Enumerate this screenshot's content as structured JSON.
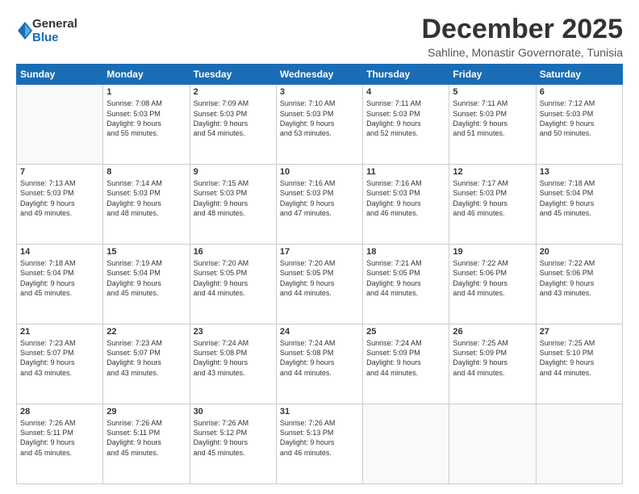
{
  "logo": {
    "general": "General",
    "blue": "Blue"
  },
  "header": {
    "title": "December 2025",
    "subtitle": "Sahline, Monastir Governorate, Tunisia"
  },
  "weekdays": [
    "Sunday",
    "Monday",
    "Tuesday",
    "Wednesday",
    "Thursday",
    "Friday",
    "Saturday"
  ],
  "weeks": [
    [
      {
        "day": "",
        "info": ""
      },
      {
        "day": "1",
        "info": "Sunrise: 7:08 AM\nSunset: 5:03 PM\nDaylight: 9 hours\nand 55 minutes."
      },
      {
        "day": "2",
        "info": "Sunrise: 7:09 AM\nSunset: 5:03 PM\nDaylight: 9 hours\nand 54 minutes."
      },
      {
        "day": "3",
        "info": "Sunrise: 7:10 AM\nSunset: 5:03 PM\nDaylight: 9 hours\nand 53 minutes."
      },
      {
        "day": "4",
        "info": "Sunrise: 7:11 AM\nSunset: 5:03 PM\nDaylight: 9 hours\nand 52 minutes."
      },
      {
        "day": "5",
        "info": "Sunrise: 7:11 AM\nSunset: 5:03 PM\nDaylight: 9 hours\nand 51 minutes."
      },
      {
        "day": "6",
        "info": "Sunrise: 7:12 AM\nSunset: 5:03 PM\nDaylight: 9 hours\nand 50 minutes."
      }
    ],
    [
      {
        "day": "7",
        "info": "Sunrise: 7:13 AM\nSunset: 5:03 PM\nDaylight: 9 hours\nand 49 minutes."
      },
      {
        "day": "8",
        "info": "Sunrise: 7:14 AM\nSunset: 5:03 PM\nDaylight: 9 hours\nand 48 minutes."
      },
      {
        "day": "9",
        "info": "Sunrise: 7:15 AM\nSunset: 5:03 PM\nDaylight: 9 hours\nand 48 minutes."
      },
      {
        "day": "10",
        "info": "Sunrise: 7:16 AM\nSunset: 5:03 PM\nDaylight: 9 hours\nand 47 minutes."
      },
      {
        "day": "11",
        "info": "Sunrise: 7:16 AM\nSunset: 5:03 PM\nDaylight: 9 hours\nand 46 minutes."
      },
      {
        "day": "12",
        "info": "Sunrise: 7:17 AM\nSunset: 5:03 PM\nDaylight: 9 hours\nand 46 minutes."
      },
      {
        "day": "13",
        "info": "Sunrise: 7:18 AM\nSunset: 5:04 PM\nDaylight: 9 hours\nand 45 minutes."
      }
    ],
    [
      {
        "day": "14",
        "info": "Sunrise: 7:18 AM\nSunset: 5:04 PM\nDaylight: 9 hours\nand 45 minutes."
      },
      {
        "day": "15",
        "info": "Sunrise: 7:19 AM\nSunset: 5:04 PM\nDaylight: 9 hours\nand 45 minutes."
      },
      {
        "day": "16",
        "info": "Sunrise: 7:20 AM\nSunset: 5:05 PM\nDaylight: 9 hours\nand 44 minutes."
      },
      {
        "day": "17",
        "info": "Sunrise: 7:20 AM\nSunset: 5:05 PM\nDaylight: 9 hours\nand 44 minutes."
      },
      {
        "day": "18",
        "info": "Sunrise: 7:21 AM\nSunset: 5:05 PM\nDaylight: 9 hours\nand 44 minutes."
      },
      {
        "day": "19",
        "info": "Sunrise: 7:22 AM\nSunset: 5:06 PM\nDaylight: 9 hours\nand 44 minutes."
      },
      {
        "day": "20",
        "info": "Sunrise: 7:22 AM\nSunset: 5:06 PM\nDaylight: 9 hours\nand 43 minutes."
      }
    ],
    [
      {
        "day": "21",
        "info": "Sunrise: 7:23 AM\nSunset: 5:07 PM\nDaylight: 9 hours\nand 43 minutes."
      },
      {
        "day": "22",
        "info": "Sunrise: 7:23 AM\nSunset: 5:07 PM\nDaylight: 9 hours\nand 43 minutes."
      },
      {
        "day": "23",
        "info": "Sunrise: 7:24 AM\nSunset: 5:08 PM\nDaylight: 9 hours\nand 43 minutes."
      },
      {
        "day": "24",
        "info": "Sunrise: 7:24 AM\nSunset: 5:08 PM\nDaylight: 9 hours\nand 44 minutes."
      },
      {
        "day": "25",
        "info": "Sunrise: 7:24 AM\nSunset: 5:09 PM\nDaylight: 9 hours\nand 44 minutes."
      },
      {
        "day": "26",
        "info": "Sunrise: 7:25 AM\nSunset: 5:09 PM\nDaylight: 9 hours\nand 44 minutes."
      },
      {
        "day": "27",
        "info": "Sunrise: 7:25 AM\nSunset: 5:10 PM\nDaylight: 9 hours\nand 44 minutes."
      }
    ],
    [
      {
        "day": "28",
        "info": "Sunrise: 7:26 AM\nSunset: 5:11 PM\nDaylight: 9 hours\nand 45 minutes."
      },
      {
        "day": "29",
        "info": "Sunrise: 7:26 AM\nSunset: 5:11 PM\nDaylight: 9 hours\nand 45 minutes."
      },
      {
        "day": "30",
        "info": "Sunrise: 7:26 AM\nSunset: 5:12 PM\nDaylight: 9 hours\nand 45 minutes."
      },
      {
        "day": "31",
        "info": "Sunrise: 7:26 AM\nSunset: 5:13 PM\nDaylight: 9 hours\nand 46 minutes."
      },
      {
        "day": "",
        "info": ""
      },
      {
        "day": "",
        "info": ""
      },
      {
        "day": "",
        "info": ""
      }
    ]
  ]
}
